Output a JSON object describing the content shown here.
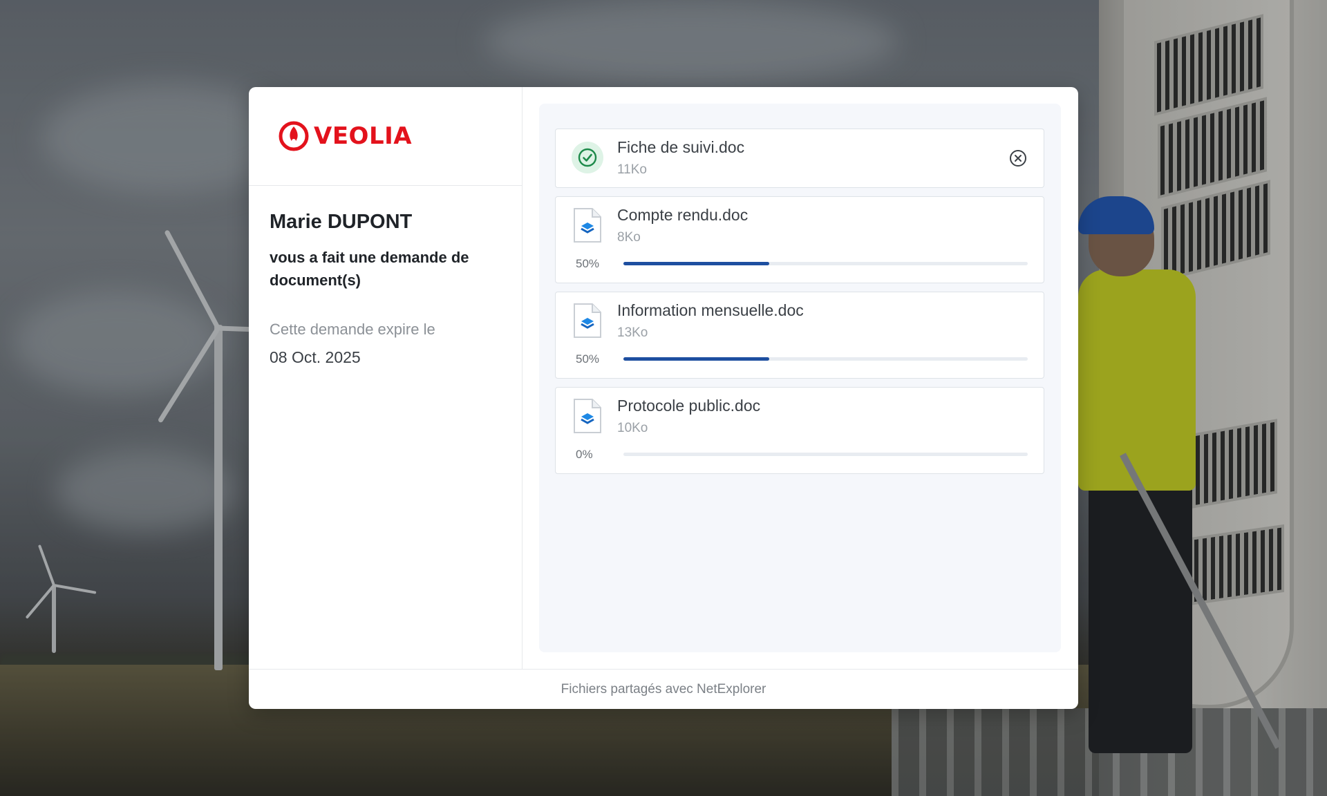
{
  "brand": {
    "name": "VEOLIA",
    "color": "#e3121c"
  },
  "request": {
    "requester": "Marie DUPONT",
    "message": "vous a fait une demande de document(s)",
    "expire_label": "Cette demande expire le",
    "expire_date": "08 Oct. 2025"
  },
  "files": [
    {
      "name": "Fiche de suivi.doc",
      "size": "11Ko",
      "status": "uploaded",
      "status_icon": "check-icon",
      "action_icon": "remove-icon"
    },
    {
      "name": "Compte rendu.doc",
      "size": "8Ko",
      "status": "uploading",
      "progress_label": "50%",
      "progress": 0.36,
      "icon": "doc-file-icon"
    },
    {
      "name": "Information mensuelle.doc",
      "size": "13Ko",
      "status": "uploading",
      "progress_label": "50%",
      "progress": 0.36,
      "icon": "doc-file-icon"
    },
    {
      "name": "Protocole public.doc",
      "size": "10Ko",
      "status": "pending",
      "progress_label": "0%",
      "progress": 0,
      "icon": "doc-file-icon"
    }
  ],
  "footer": {
    "text": "Fichiers partagés avec NetExplorer"
  },
  "colors": {
    "progress": "#1e4fa0",
    "success": "#1d8a4a"
  }
}
